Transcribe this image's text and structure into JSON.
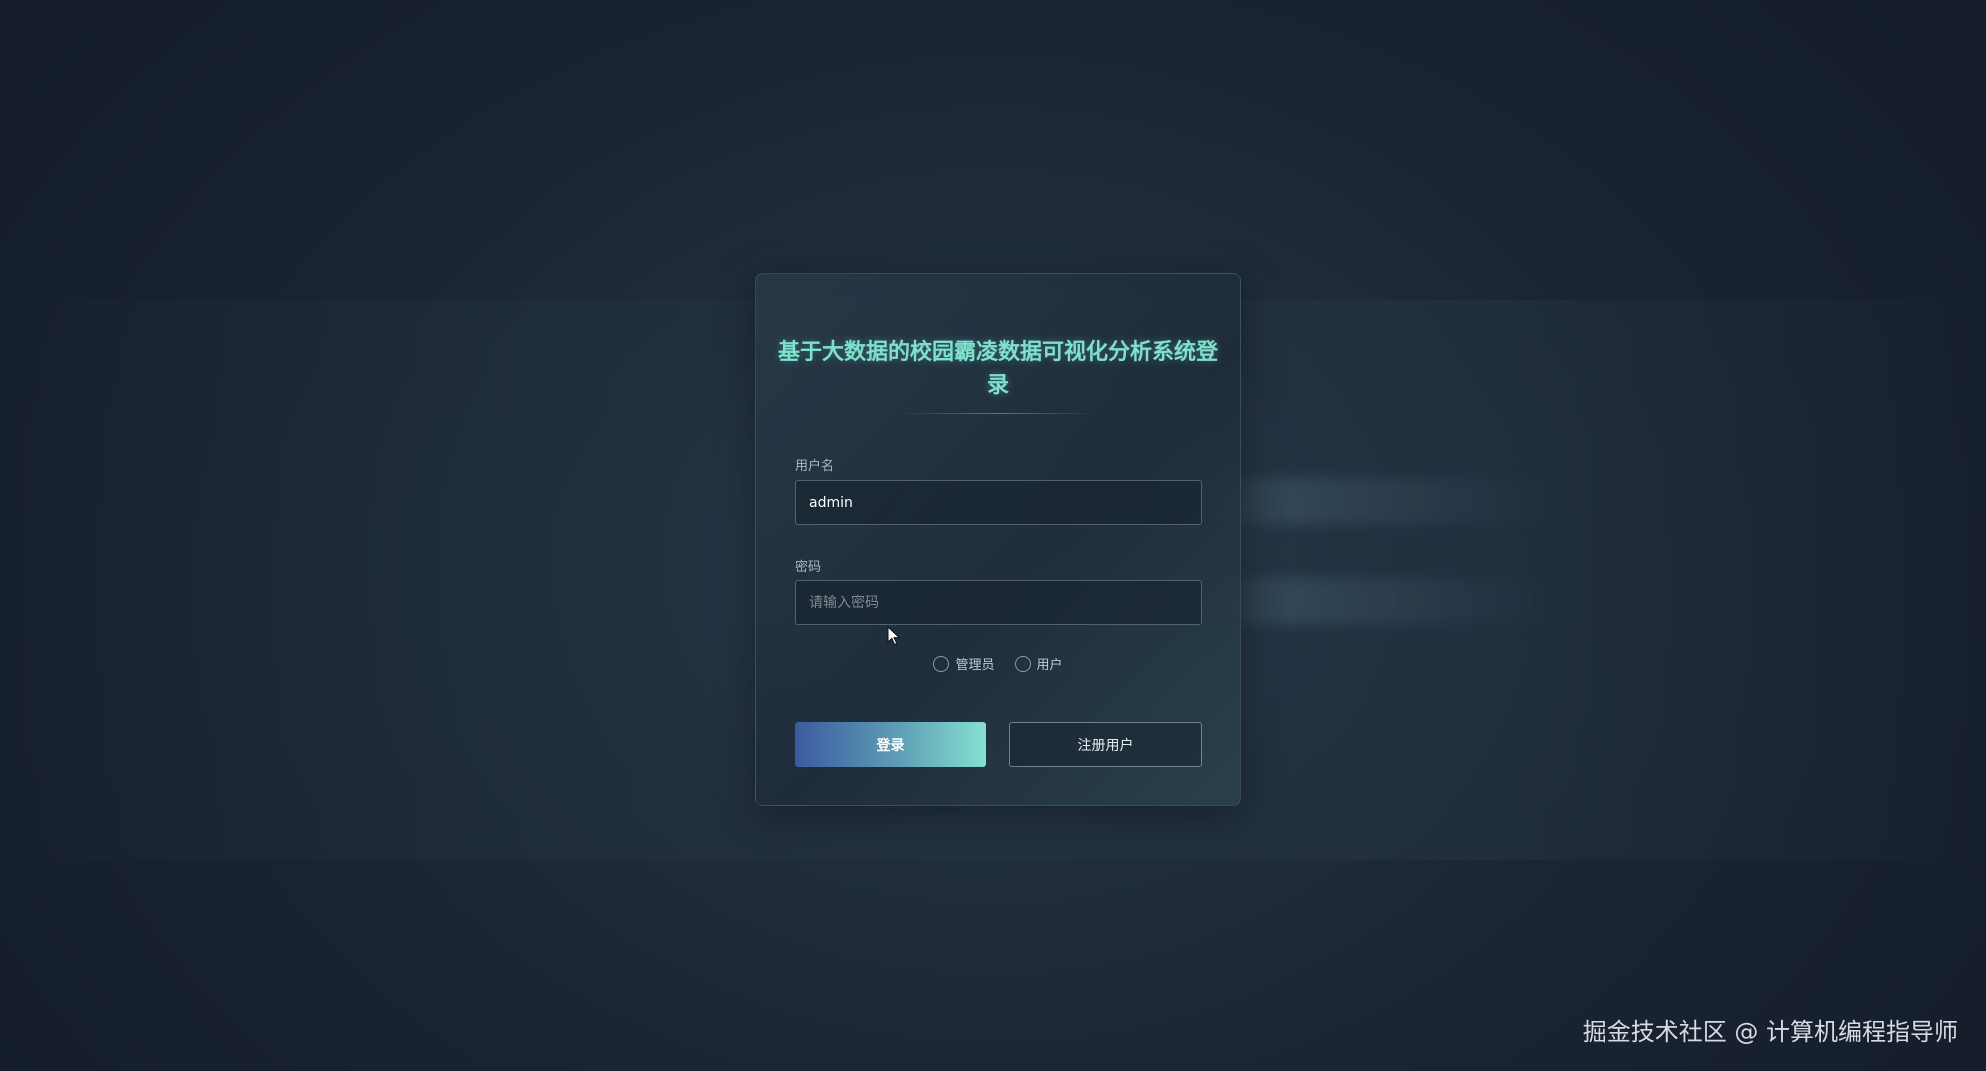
{
  "login": {
    "title": "基于大数据的校园霸凌数据可视化分析系统登录",
    "username_label": "用户名",
    "username_value": "admin",
    "password_label": "密码",
    "password_placeholder": "请输入密码",
    "password_value": "",
    "roles": [
      {
        "label": "管理员",
        "selected": false
      },
      {
        "label": "用户",
        "selected": false
      }
    ],
    "login_button": "登录",
    "register_button": "注册用户"
  },
  "watermark": "掘金技术社区 @ 计算机编程指导师",
  "colors": {
    "title": "#7fe0cc",
    "login_gradient_start": "#3b5aa0",
    "login_gradient_end": "#86e0d0",
    "background": "#1a2434"
  }
}
